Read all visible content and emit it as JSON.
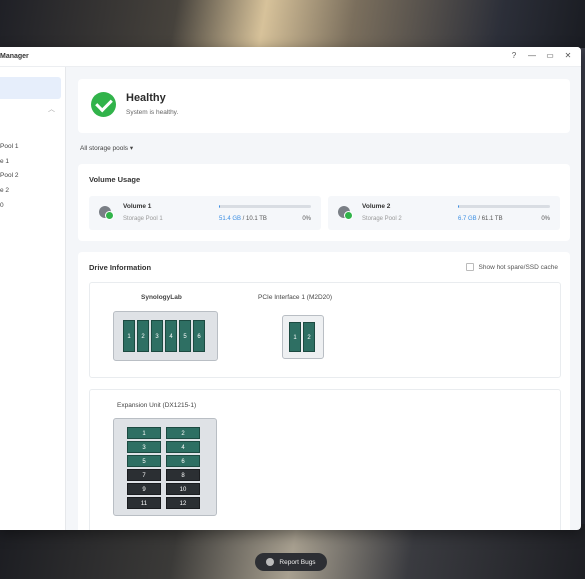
{
  "window": {
    "title": "Manager",
    "controls": [
      "?",
      "—",
      "▭",
      "✕"
    ]
  },
  "sidebar": {
    "items": [
      {
        "label": "Pool 1"
      },
      {
        "label": "e 1"
      },
      {
        "label": "Pool 2"
      },
      {
        "label": "e 2"
      },
      {
        "label": "0"
      }
    ]
  },
  "status": {
    "title": "Healthy",
    "subtitle": "System is healthy.",
    "icon": "check-icon",
    "color": "#31b34a"
  },
  "filter": {
    "label": "All storage pools ▾"
  },
  "volume_usage": {
    "title": "Volume Usage",
    "volumes": [
      {
        "name": "Volume 1",
        "pool": "Storage Pool 1",
        "used": "51.4 GB",
        "total": " / 10.1 TB",
        "percent": "0%",
        "fill": 0.01
      },
      {
        "name": "Volume 2",
        "pool": "Storage Pool 2",
        "used": "6.7 GB",
        "total": " / 61.1 TB",
        "percent": "0%",
        "fill": 0.01
      }
    ]
  },
  "drive_info": {
    "title": "Drive Information",
    "hotspare_label": "Show hot spare/SSD cache",
    "devices": {
      "main": {
        "label": "SynologyLab",
        "bays": [
          "1",
          "2",
          "3",
          "4",
          "5",
          "6"
        ]
      },
      "pcie": {
        "label": "PCIe Interface 1 (M2D20)",
        "bays": [
          "1",
          "2"
        ]
      },
      "expansion": {
        "label": "Expansion Unit (DX1215-1)",
        "bays": [
          "1",
          "2",
          "3",
          "4",
          "5",
          "6",
          "7",
          "8",
          "9",
          "10",
          "11",
          "12"
        ]
      }
    }
  },
  "report_bugs": {
    "label": "Report Bugs"
  }
}
